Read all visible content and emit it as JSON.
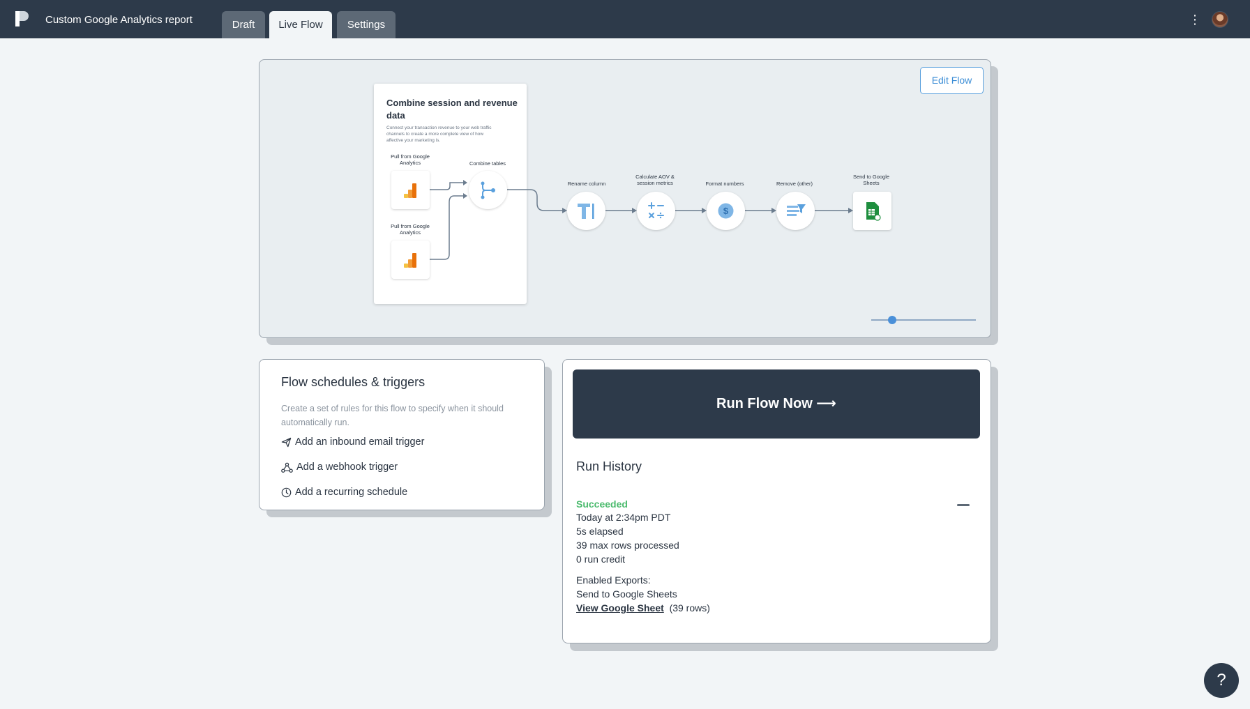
{
  "header": {
    "app_title": "Custom Google Analytics report",
    "tabs": [
      {
        "label": "Draft"
      },
      {
        "label": "Live Flow"
      },
      {
        "label": "Settings"
      }
    ],
    "active_tab": "Live Flow",
    "menu_icon": "⋮"
  },
  "canvas": {
    "edit_button": "Edit Flow",
    "group": {
      "title": "Combine session and revenue data",
      "description": "Connect your transaction revenue to your web traffic channels to create a more complete view of how affective your marketing is."
    },
    "nodes": [
      {
        "label": "Pull from Google Analytics",
        "icon": "google-analytics-icon"
      },
      {
        "label": "Pull from Google Analytics",
        "icon": "google-analytics-icon"
      },
      {
        "label": "Combine tables",
        "icon": "combine-icon"
      },
      {
        "label": "Rename column",
        "icon": "text-cursor-icon"
      },
      {
        "label": "Calculate AOV & session metrics",
        "icon": "calculator-icon"
      },
      {
        "label": "Format numbers",
        "icon": "dollar-icon"
      },
      {
        "label": "Remove (other)",
        "icon": "filter-icon"
      },
      {
        "label": "Send to Google Sheets",
        "icon": "google-sheets-icon"
      }
    ],
    "zoom_level": 0.2
  },
  "schedules": {
    "title": "Flow schedules & triggers",
    "description": "Create a set of rules for this flow to specify when it should automatically run.",
    "triggers": [
      {
        "label": "Add an inbound email trigger",
        "icon": "paper-plane-icon"
      },
      {
        "label": "Add a webhook trigger",
        "icon": "webhook-icon"
      },
      {
        "label": "Add a recurring schedule",
        "icon": "clock-icon"
      }
    ]
  },
  "run": {
    "button_label": "Run Flow Now ⟶",
    "history_title": "Run History",
    "status": "Succeeded",
    "time": "Today at 2:34pm PDT",
    "elapsed": "5s elapsed",
    "rows": "39 max rows processed",
    "credit": "0 run credit",
    "exports_label": "Enabled Exports:",
    "export_name": "Send to Google Sheets",
    "link_text": "View Google Sheet",
    "link_rows": "(39 rows)"
  },
  "help_label": "?",
  "colors": {
    "header_bg": "#2d3a4a",
    "accent": "#3b8dd6",
    "success": "#4cbb6e",
    "page_bg": "#f2f5f7"
  }
}
